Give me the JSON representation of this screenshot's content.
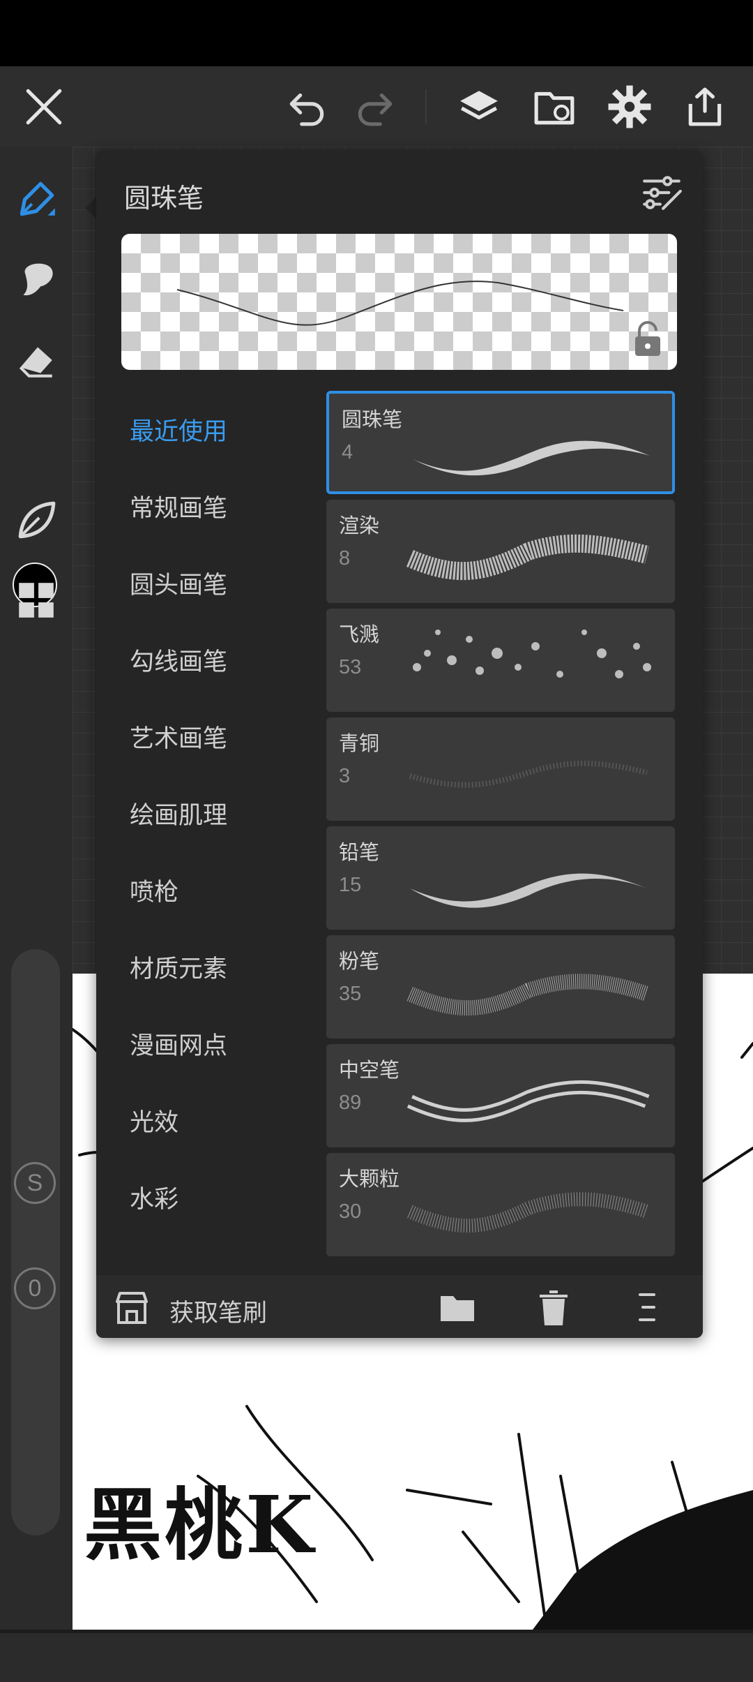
{
  "toolbar": {
    "close": "close",
    "undo": "undo",
    "redo": "redo",
    "layers": "layers",
    "import": "import",
    "settings": "settings",
    "share": "share"
  },
  "tools": [
    "brush",
    "smudge",
    "eraser",
    "color",
    "leaf",
    "grid"
  ],
  "color": {
    "current": "#000000",
    "accent": "#2f8fe6"
  },
  "sliders": {
    "size_badge": "S",
    "opacity_badge": "0"
  },
  "panel": {
    "title": "圆珠笔",
    "categories": [
      {
        "label": "最近使用",
        "active": true
      },
      {
        "label": "常规画笔",
        "active": false
      },
      {
        "label": "圆头画笔",
        "active": false
      },
      {
        "label": "勾线画笔",
        "active": false
      },
      {
        "label": "艺术画笔",
        "active": false
      },
      {
        "label": "绘画肌理",
        "active": false
      },
      {
        "label": "喷枪",
        "active": false
      },
      {
        "label": "材质元素",
        "active": false
      },
      {
        "label": "漫画网点",
        "active": false
      },
      {
        "label": "光效",
        "active": false
      },
      {
        "label": "水彩",
        "active": false
      }
    ],
    "brushes": [
      {
        "name": "圆珠笔",
        "size": "4",
        "selected": true,
        "style": "smooth"
      },
      {
        "name": "渲染",
        "size": "8",
        "selected": false,
        "style": "rough"
      },
      {
        "name": "飞溅",
        "size": "53",
        "selected": false,
        "style": "splatter"
      },
      {
        "name": "青铜",
        "size": "3",
        "selected": false,
        "style": "faint"
      },
      {
        "name": "铅笔",
        "size": "15",
        "selected": false,
        "style": "smooth"
      },
      {
        "name": "粉笔",
        "size": "35",
        "selected": false,
        "style": "grainy"
      },
      {
        "name": "中空笔",
        "size": "89",
        "selected": false,
        "style": "hollow"
      },
      {
        "name": "大颗粒",
        "size": "30",
        "selected": false,
        "style": "grainy"
      }
    ],
    "footer": {
      "get_brushes": "获取笔刷"
    }
  },
  "canvas": {
    "title_text": "黑桃K"
  }
}
